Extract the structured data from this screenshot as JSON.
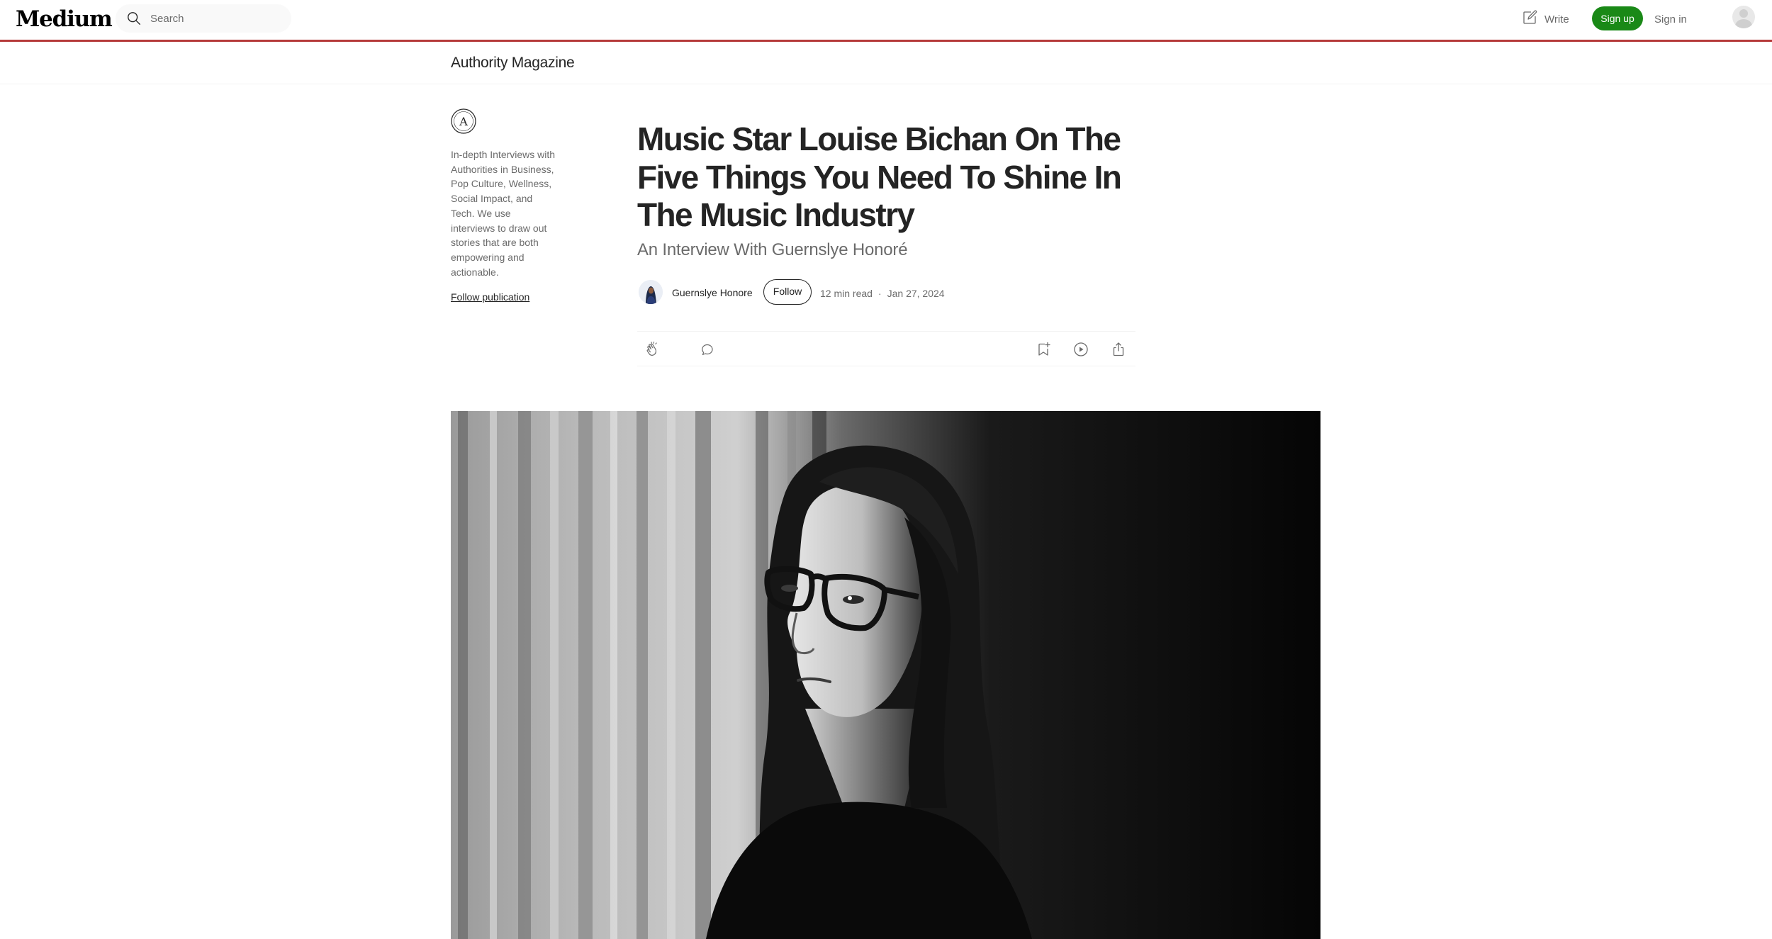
{
  "nav": {
    "logo": "Medium",
    "search_placeholder": "Search",
    "write_label": "Write",
    "signup_label": "Sign up",
    "signin_label": "Sign in",
    "icons": {
      "search": "search-icon",
      "write": "write-icon",
      "avatar": "user-avatar"
    }
  },
  "publication": {
    "name": "Authority Magazine",
    "logo_letter": "A",
    "description": "In-depth Interviews with Authorities in Business, Pop Culture, Wellness, Social Impact, and Tech. We use interviews to draw out stories that are both empowering and actionable.",
    "follow_label": "Follow publication"
  },
  "article": {
    "title": "Music Star Louise Bichan On The Five Things You Need To Shine In The Music Industry",
    "subtitle": "An Interview With Guernslye Honoré",
    "author": "Guernslye Honore",
    "follow_label": "Follow",
    "read_time": "12 min read",
    "separator": "·",
    "date": "Jan 27, 2024",
    "actions": [
      "clap-icon",
      "comment-icon",
      "bookmark-icon",
      "listen-icon",
      "share-icon"
    ]
  },
  "colors": {
    "accent_green": "#1a8917",
    "nav_underline": "#b53a3a",
    "text_primary": "#242424",
    "text_secondary": "#6b6b6b"
  }
}
